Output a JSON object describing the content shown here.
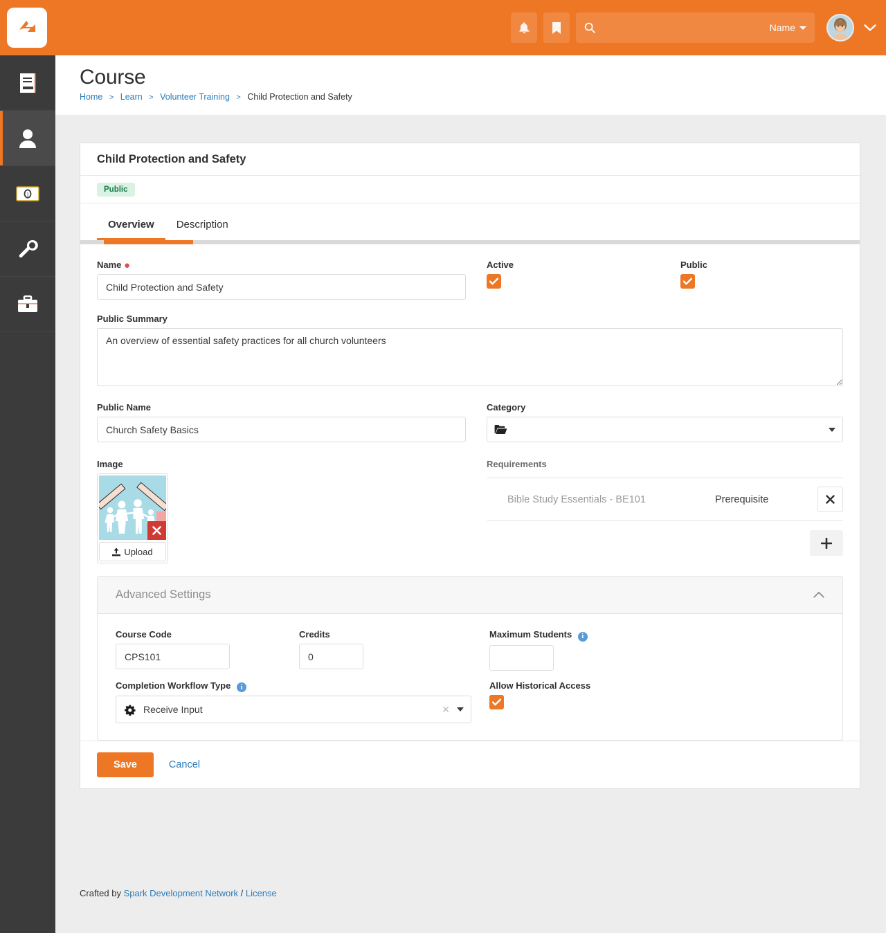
{
  "topbar": {
    "logo_icon": "rock-rms-logo-icon",
    "notifications_icon": "bell-icon",
    "bookmarks_icon": "bookmark-icon",
    "search": {
      "icon": "search-icon",
      "value": "",
      "placeholder": ""
    },
    "name_dropdown_label": "Name",
    "avatar_icon": "user-avatar",
    "account_chevron_icon": "chevron-down-icon",
    "accent_color": "#ee7725"
  },
  "sidebar": {
    "items": [
      {
        "icon": "book-icon",
        "name": "cms",
        "active": false
      },
      {
        "icon": "person-icon",
        "name": "people",
        "active": true
      },
      {
        "icon": "money-bill-icon",
        "name": "finance",
        "active": false
      },
      {
        "icon": "wrench-icon",
        "name": "admin-tools",
        "active": false
      },
      {
        "icon": "briefcase-icon",
        "name": "reporting",
        "active": false
      }
    ]
  },
  "page": {
    "title": "Course",
    "breadcrumb": [
      {
        "label": "Home",
        "link": true
      },
      {
        "label": "Learn",
        "link": true
      },
      {
        "label": "Volunteer Training",
        "link": true
      },
      {
        "label": "Child Protection and Safety",
        "link": false
      }
    ],
    "breadcrumb_separator": ">"
  },
  "panel": {
    "heading": "Child Protection and Safety",
    "badge": {
      "label": "Public",
      "bg": "#d9f2e3",
      "fg": "#1c7a4a"
    },
    "tabs": [
      {
        "label": "Overview",
        "active": true
      },
      {
        "label": "Description",
        "active": false
      }
    ]
  },
  "form": {
    "name": {
      "label": "Name",
      "required_marker": "●",
      "value": "Child Protection and Safety",
      "placeholder": ""
    },
    "active": {
      "label": "Active",
      "checked": true
    },
    "public": {
      "label": "Public",
      "checked": true
    },
    "public_summary": {
      "label": "Public Summary",
      "value": "An overview of essential safety practices for all church volunteers",
      "placeholder": ""
    },
    "public_name": {
      "label": "Public Name",
      "value": "Church Safety Basics",
      "placeholder": ""
    },
    "category": {
      "label": "Category",
      "icon": "folder-open-icon",
      "value": "",
      "caret_icon": "caret-down-icon"
    },
    "image": {
      "label": "Image",
      "thumbnail_icon": "family-paper-cutout-photo",
      "delete_icon": "close-x-icon",
      "upload_label": "Upload",
      "upload_icon": "upload-icon"
    },
    "requirements": {
      "title": "Requirements",
      "rows": [
        {
          "name": "Bible Study Essentials - BE101",
          "type": "Prerequisite",
          "remove_icon": "close-x-icon"
        }
      ],
      "add_icon": "plus-icon"
    }
  },
  "advanced": {
    "title": "Advanced Settings",
    "collapse_icon": "chevron-up-icon",
    "course_code": {
      "label": "Course Code",
      "value": "CPS101",
      "placeholder": ""
    },
    "credits": {
      "label": "Credits",
      "value": "0",
      "placeholder": ""
    },
    "maximum_students": {
      "label": "Maximum Students",
      "value": "",
      "placeholder": "",
      "info_icon": "info-icon"
    },
    "completion_workflow_type": {
      "label": "Completion Workflow Type",
      "info_icon": "info-icon",
      "prefix_icon": "cogs-icon",
      "value": "Receive Input",
      "clear_icon": "close-x-icon",
      "caret_icon": "caret-down-icon"
    },
    "allow_historical_access": {
      "label": "Allow Historical Access",
      "checked": true
    }
  },
  "actions": {
    "save_label": "Save",
    "cancel_label": "Cancel"
  },
  "footer": {
    "prefix": "Crafted by ",
    "org_link": "Spark Development Network",
    "divider": " / ",
    "license_link": "License"
  }
}
